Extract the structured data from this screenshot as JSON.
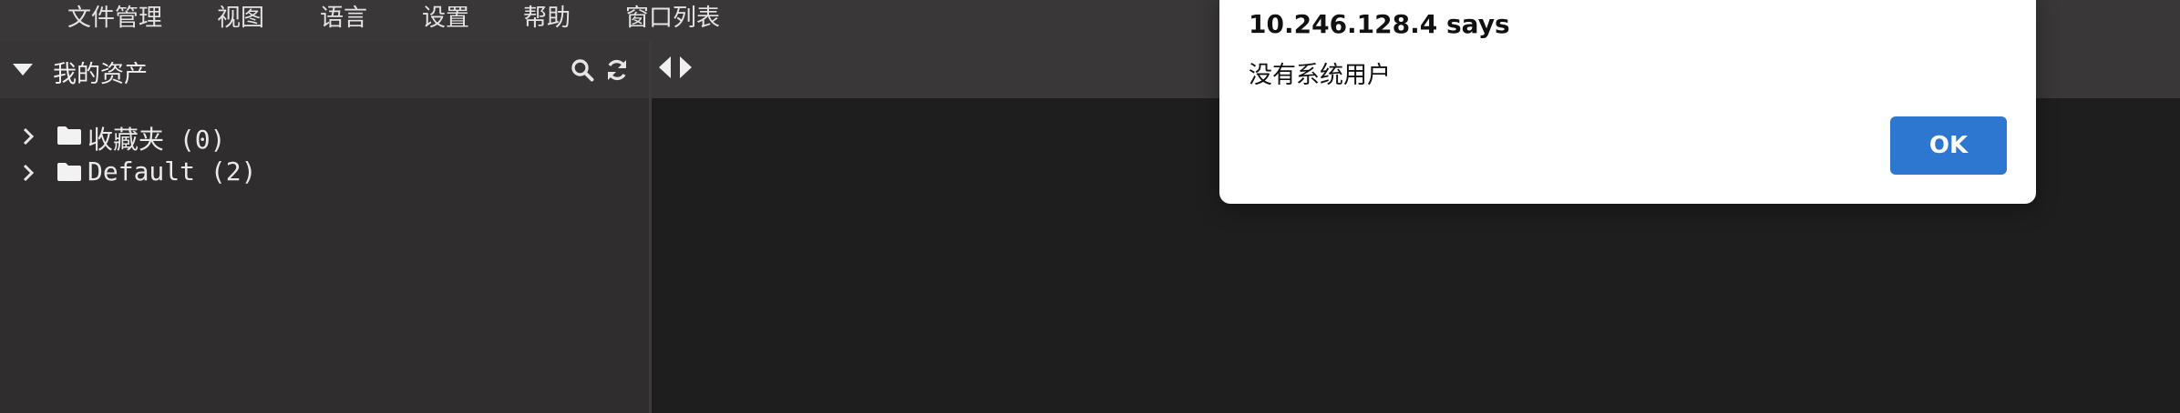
{
  "menubar": {
    "items": [
      {
        "label": "文件管理"
      },
      {
        "label": "视图"
      },
      {
        "label": "语言"
      },
      {
        "label": "设置"
      },
      {
        "label": "帮助"
      },
      {
        "label": "窗口列表"
      }
    ]
  },
  "sidebar": {
    "title": "我的资产",
    "tree": [
      {
        "label": "收藏夹 (0)"
      },
      {
        "label": "Default (2)"
      }
    ]
  },
  "dialog": {
    "title": "10.246.128.4 says",
    "message": "没有系统用户",
    "ok_label": "OK"
  },
  "colors": {
    "accent": "#2e77d0",
    "menubar": "#393737",
    "sidebar": "#2f2d2d",
    "content": "#1f1e1e"
  },
  "icons": [
    "caret-down-icon",
    "search-icon",
    "refresh-icon",
    "caret-left-icon",
    "caret-right-icon",
    "chevron-right-icon",
    "folder-icon"
  ]
}
